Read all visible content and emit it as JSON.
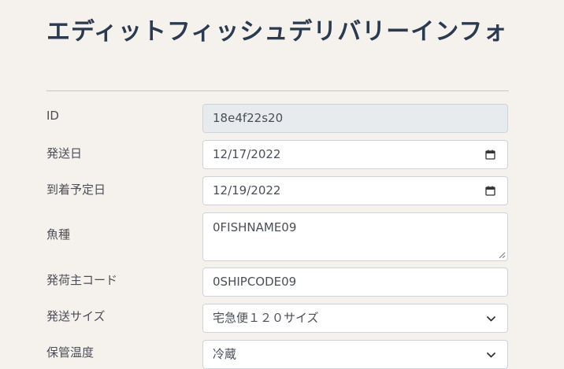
{
  "page": {
    "title": "エディットフィッシュデリバリーインフォ"
  },
  "form": {
    "id": {
      "label": "ID",
      "value": "18e4f22s20"
    },
    "ship_date": {
      "label": "発送日",
      "value": "12/17/2022",
      "icon": "calendar-icon"
    },
    "arrival_date": {
      "label": "到着予定日",
      "value": "12/19/2022",
      "icon": "calendar-icon"
    },
    "fish_type": {
      "label": "魚種",
      "value": "0FISHNAME09"
    },
    "shipper_code": {
      "label": "発荷主コード",
      "value": "0SHIPCODE09"
    },
    "ship_size": {
      "label": "発送サイズ",
      "value": "宅急便１２０サイズ",
      "icon": "chevron-down-icon"
    },
    "storage_temp": {
      "label": "保管温度",
      "value": "冷蔵",
      "icon": "chevron-down-icon"
    }
  }
}
